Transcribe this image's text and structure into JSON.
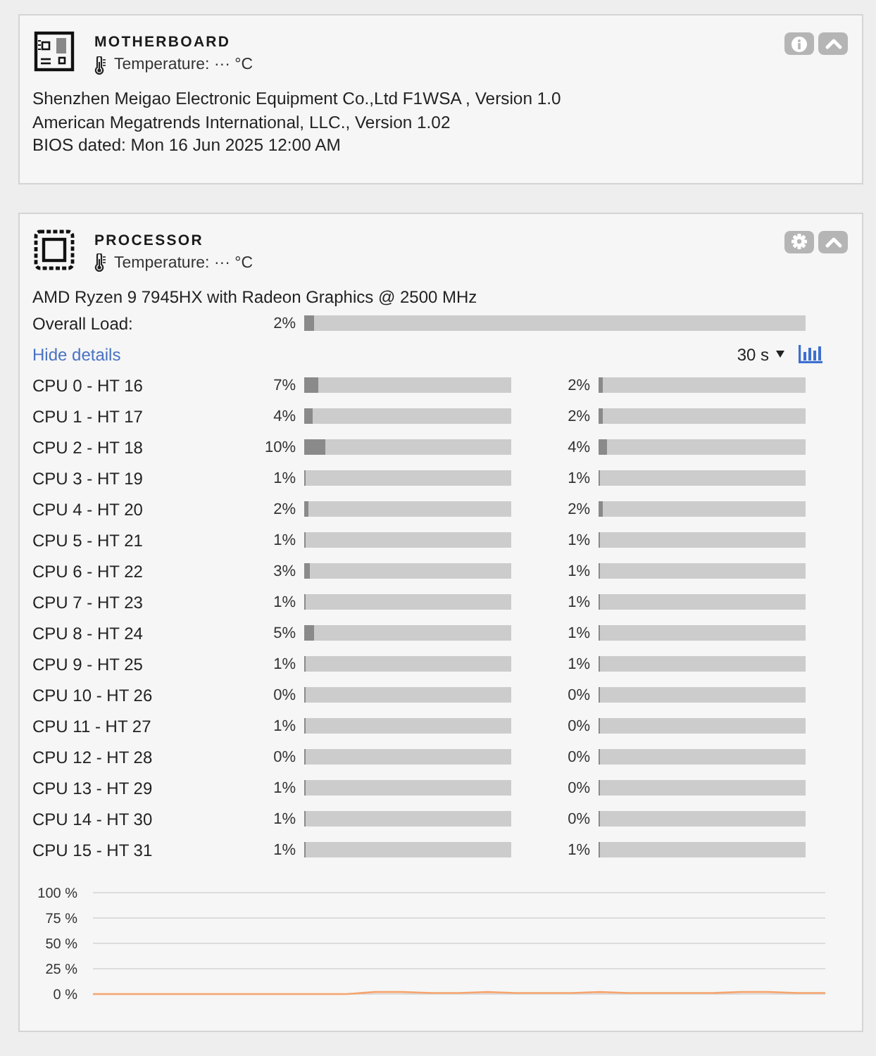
{
  "motherboard": {
    "title": "MOTHERBOARD",
    "temperature": "Temperature: ··· °C",
    "actions": [
      {
        "kind": "info"
      },
      {
        "kind": "collapse"
      }
    ],
    "details": [
      "Shenzhen Meigao Electronic Equipment Co.,Ltd F1WSA , Version 1.0",
      "American Megatrends International, LLC., Version 1.02",
      "BIOS dated: Mon 16 Jun 2025 12:00 AM"
    ]
  },
  "processor": {
    "title": "PROCESSOR",
    "temperature": "Temperature: ··· °C",
    "actions": [
      {
        "kind": "settings"
      },
      {
        "kind": "collapse"
      }
    ],
    "model": "AMD Ryzen 9 7945HX with Radeon Graphics @ 2500 MHz",
    "overall_load": {
      "label": "Overall Load:",
      "reading": "2%",
      "level": 0.02
    },
    "details_link": "Hide details",
    "interval": "30 s",
    "cpus": [
      {
        "name": "CPU 0 - HT 16",
        "core": {
          "reading": "7%",
          "level": 0.07
        },
        "thread": {
          "reading": "2%",
          "level": 0.02
        }
      },
      {
        "name": "CPU 1 - HT 17",
        "core": {
          "reading": "4%",
          "level": 0.04
        },
        "thread": {
          "reading": "2%",
          "level": 0.02
        }
      },
      {
        "name": "CPU 2 - HT 18",
        "core": {
          "reading": "10%",
          "level": 0.1
        },
        "thread": {
          "reading": "4%",
          "level": 0.04
        }
      },
      {
        "name": "CPU 3 - HT 19",
        "core": {
          "reading": "1%",
          "level": 0.01
        },
        "thread": {
          "reading": "1%",
          "level": 0.01
        }
      },
      {
        "name": "CPU 4 - HT 20",
        "core": {
          "reading": "2%",
          "level": 0.02
        },
        "thread": {
          "reading": "2%",
          "level": 0.02
        }
      },
      {
        "name": "CPU 5 - HT 21",
        "core": {
          "reading": "1%",
          "level": 0.01
        },
        "thread": {
          "reading": "1%",
          "level": 0.01
        }
      },
      {
        "name": "CPU 6 - HT 22",
        "core": {
          "reading": "3%",
          "level": 0.03
        },
        "thread": {
          "reading": "1%",
          "level": 0.01
        }
      },
      {
        "name": "CPU 7 - HT 23",
        "core": {
          "reading": "1%",
          "level": 0.01
        },
        "thread": {
          "reading": "1%",
          "level": 0.01
        }
      },
      {
        "name": "CPU 8 - HT 24",
        "core": {
          "reading": "5%",
          "level": 0.05
        },
        "thread": {
          "reading": "1%",
          "level": 0.01
        }
      },
      {
        "name": "CPU 9 - HT 25",
        "core": {
          "reading": "1%",
          "level": 0.01
        },
        "thread": {
          "reading": "1%",
          "level": 0.01
        }
      },
      {
        "name": "CPU 10 - HT 26",
        "core": {
          "reading": "0%",
          "level": 0
        },
        "thread": {
          "reading": "0%",
          "level": 0
        }
      },
      {
        "name": "CPU 11 - HT 27",
        "core": {
          "reading": "1%",
          "level": 0.01
        },
        "thread": {
          "reading": "0%",
          "level": 0
        }
      },
      {
        "name": "CPU 12 - HT 28",
        "core": {
          "reading": "0%",
          "level": 0
        },
        "thread": {
          "reading": "0%",
          "level": 0
        }
      },
      {
        "name": "CPU 13 - HT 29",
        "core": {
          "reading": "1%",
          "level": 0.01
        },
        "thread": {
          "reading": "0%",
          "level": 0
        }
      },
      {
        "name": "CPU 14 - HT 30",
        "core": {
          "reading": "1%",
          "level": 0.01
        },
        "thread": {
          "reading": "0%",
          "level": 0
        }
      },
      {
        "name": "CPU 15 - HT 31",
        "core": {
          "reading": "1%",
          "level": 0.01
        },
        "thread": {
          "reading": "1%",
          "level": 0.01
        }
      }
    ],
    "chart_data": {
      "type": "line",
      "grid": true,
      "ylim": [
        0,
        100
      ],
      "yticks": [
        {
          "value": 100,
          "label": "100 %"
        },
        {
          "value": 75,
          "label": "75 %"
        },
        {
          "value": 50,
          "label": "50 %"
        },
        {
          "value": 25,
          "label": "25 %"
        },
        {
          "value": 0,
          "label": "0 %"
        }
      ],
      "series": [
        {
          "color": "#f5a46e",
          "values": [
            0,
            0,
            0,
            0,
            0,
            0,
            0,
            0,
            0,
            0,
            2,
            2,
            1,
            1,
            2,
            1,
            1,
            1,
            2,
            1,
            1,
            1,
            1,
            2,
            2,
            1,
            1
          ]
        }
      ]
    }
  }
}
